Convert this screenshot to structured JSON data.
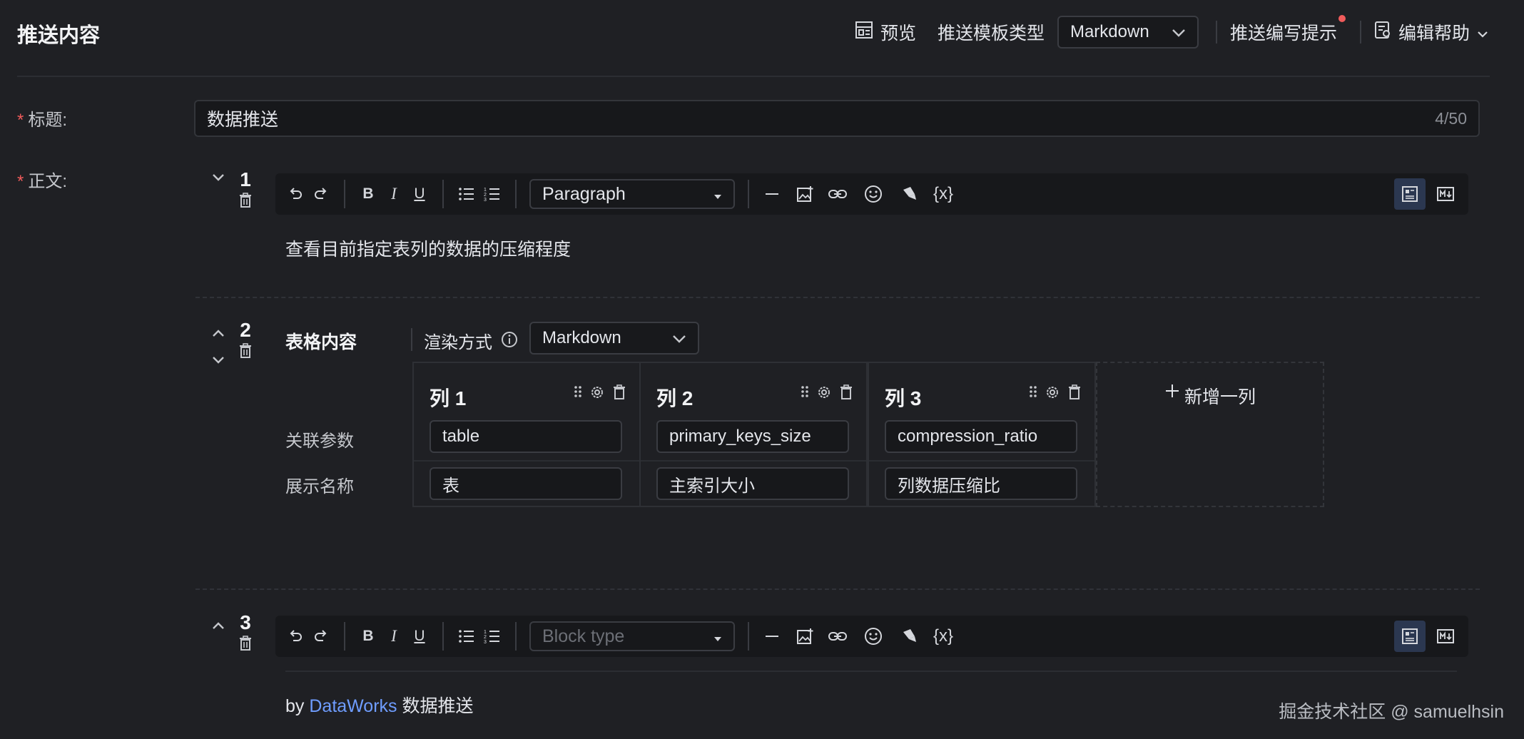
{
  "header": {
    "title": "推送内容",
    "preview_label": "预览",
    "template_type_label": "推送模板类型",
    "template_type_value": "Markdown",
    "writing_tips_label": "推送编写提示",
    "edit_help_label": "编辑帮助"
  },
  "form": {
    "title_label": "标题:",
    "title_value": "数据推送",
    "title_count": "4/50",
    "body_label": "正文:"
  },
  "blocks": [
    {
      "number": "1",
      "block_type": "Paragraph",
      "text": "查看目前指定表列的数据的压缩程度"
    },
    {
      "number": "2",
      "title": "表格内容",
      "render_label": "渲染方式",
      "render_value": "Markdown",
      "row_labels": [
        "关联参数",
        "展示名称"
      ],
      "columns": [
        {
          "name": "列 1",
          "param": "table",
          "display": "表"
        },
        {
          "name": "列 2",
          "param": "primary_keys_size",
          "display": "主索引大小"
        },
        {
          "name": "列 3",
          "param": "compression_ratio",
          "display": "列数据压缩比"
        }
      ],
      "add_column_label": "新增一列"
    },
    {
      "number": "3",
      "block_type_placeholder": "Block type",
      "text_prefix": "by",
      "link_text": "DataWorks",
      "text_suffix": "数据推送"
    }
  ],
  "toolbar": {
    "variable_label": "{x}"
  },
  "watermark": "掘金技术社区 @ samuelhsin",
  "colors": {
    "background": "#1f2024",
    "required": "#f05b5b",
    "link": "#6f9dff",
    "notification_dot": "#f05b5b"
  }
}
